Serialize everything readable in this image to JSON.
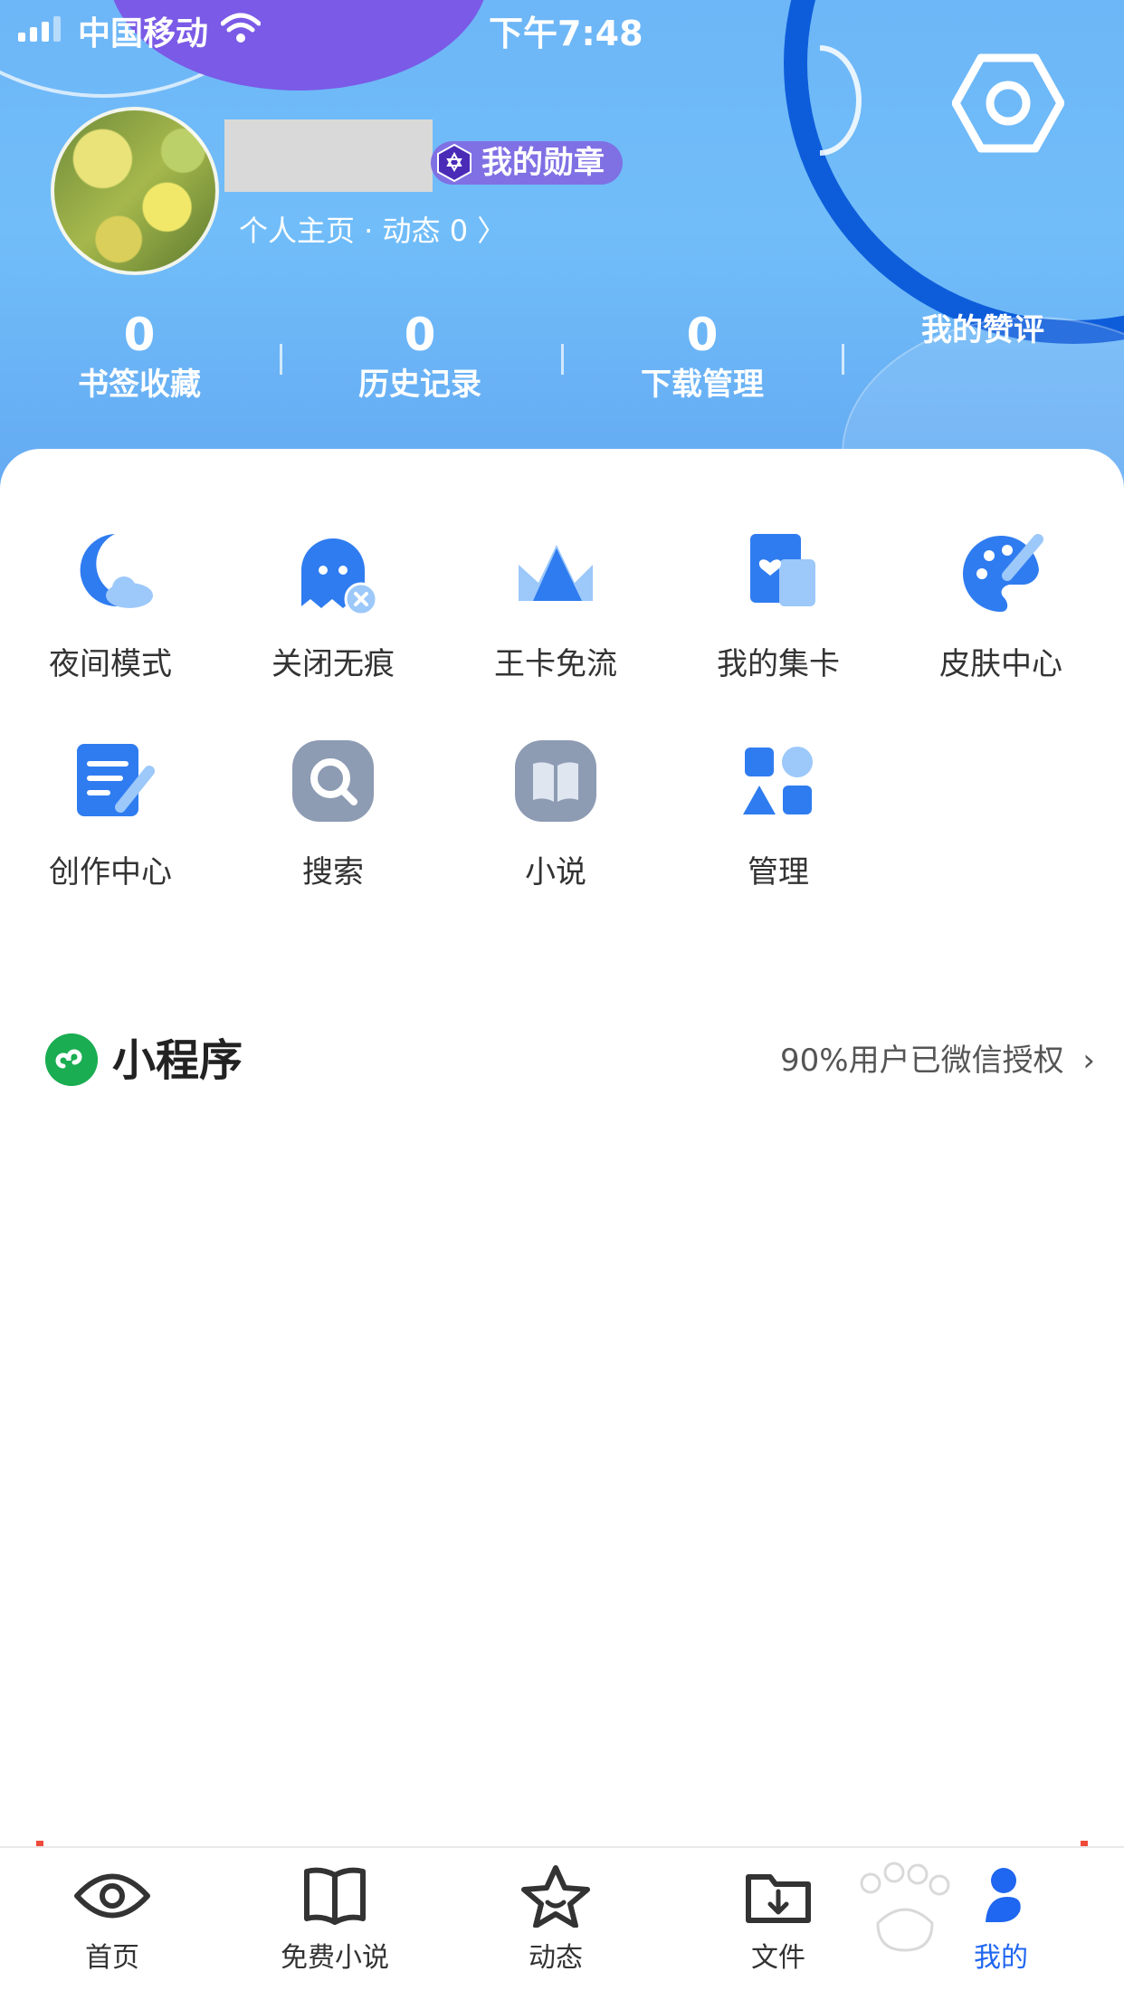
{
  "status_bar": {
    "carrier": "中国移动",
    "time": "下午7:48"
  },
  "profile": {
    "badge": "我的勋章",
    "link": "个人主页 · 动态 0 〉"
  },
  "stats": [
    {
      "value": "0",
      "label": "书签收藏"
    },
    {
      "value": "0",
      "label": "历史记录"
    },
    {
      "value": "0",
      "label": "下载管理"
    },
    {
      "value": "",
      "label": "我的赞评"
    }
  ],
  "features": [
    {
      "label": "夜间模式",
      "icon": "moon-icon"
    },
    {
      "label": "关闭无痕",
      "icon": "ghost-icon"
    },
    {
      "label": "王卡免流",
      "icon": "crown-icon"
    },
    {
      "label": "我的集卡",
      "icon": "card-icon"
    },
    {
      "label": "皮肤中心",
      "icon": "palette-icon"
    },
    {
      "label": "创作中心",
      "icon": "document-edit-icon"
    },
    {
      "label": "搜索",
      "icon": "search-icon"
    },
    {
      "label": "小说",
      "icon": "book-icon"
    },
    {
      "label": "管理",
      "icon": "apps-icon"
    }
  ],
  "mini_program": {
    "title": "小程序",
    "right_text": "90%用户已微信授权"
  },
  "tabs": [
    {
      "label": "首页",
      "icon": "eye-icon"
    },
    {
      "label": "免费小说",
      "icon": "open-book-icon"
    },
    {
      "label": "动态",
      "icon": "star-icon"
    },
    {
      "label": "文件",
      "icon": "folder-download-icon"
    },
    {
      "label": "我的",
      "icon": "profile-icon",
      "active": true
    }
  ],
  "colors": {
    "accent": "#1f66f0",
    "header": "#6db6f7",
    "ring": "#0d5ddb",
    "badge": "#7f70e4",
    "mini_green": "#1aad52"
  }
}
